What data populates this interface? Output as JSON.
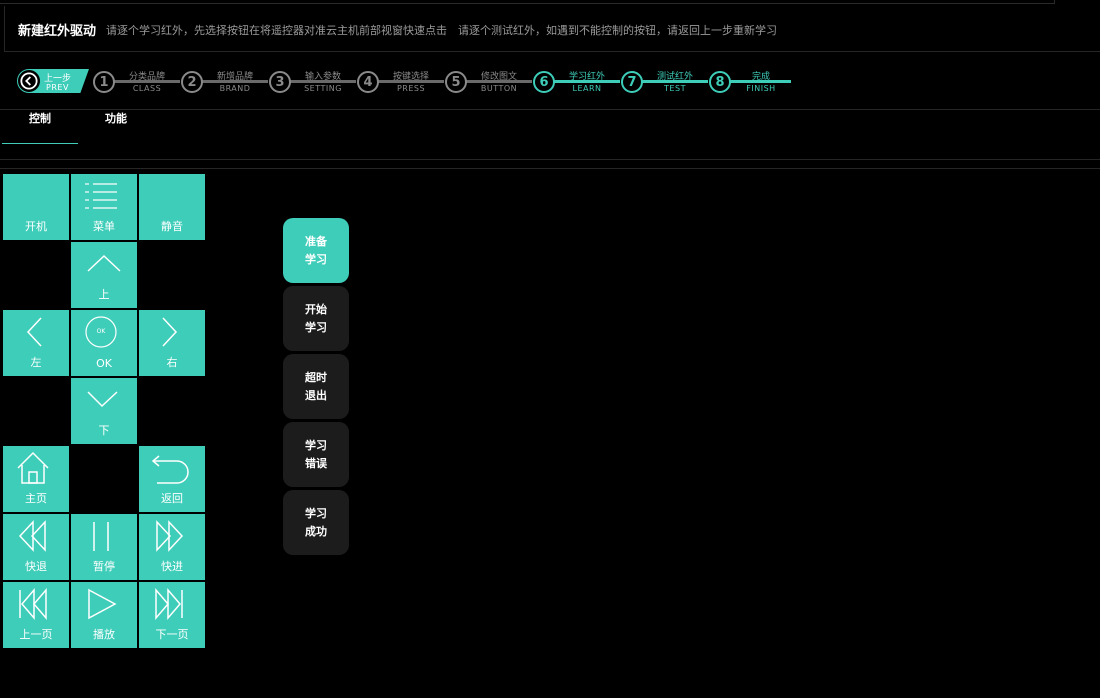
{
  "header": {
    "title": "新建红外驱动",
    "hint": "请逐个学习红外，先选择按钮在将遥控器对准云主机前部视窗快速点击　请逐个测试红外，如遇到不能控制的按钮，请返回上一步重新学习"
  },
  "prev": {
    "label": "上一步",
    "sub": "PREV"
  },
  "steps": [
    {
      "num": "1",
      "label": "分类品牌",
      "sub": "CLASS",
      "active": false
    },
    {
      "num": "2",
      "label": "新增品牌",
      "sub": "BRAND",
      "active": false
    },
    {
      "num": "3",
      "label": "输入参数",
      "sub": "SETTING",
      "active": false
    },
    {
      "num": "4",
      "label": "按键选择",
      "sub": "PRESS",
      "active": false
    },
    {
      "num": "5",
      "label": "修改图文",
      "sub": "BUTTON",
      "active": false
    },
    {
      "num": "6",
      "label": "学习红外",
      "sub": "LEARN",
      "active": true
    },
    {
      "num": "7",
      "label": "测试红外",
      "sub": "TEST",
      "active": true
    },
    {
      "num": "8",
      "label": "完成",
      "sub": "FINISH",
      "active": true
    }
  ],
  "tabs": [
    {
      "label": "控制",
      "active": true
    },
    {
      "label": "功能",
      "active": false
    }
  ],
  "keys": {
    "power": "开机",
    "menu": "菜单",
    "mute": "静音",
    "up": "上",
    "left": "左",
    "ok": "OK",
    "ok_icon": "OK",
    "right": "右",
    "down": "下",
    "home": "主页",
    "back": "返回",
    "rewind": "快退",
    "pause": "暂停",
    "forward": "快进",
    "prev_page": "上一页",
    "play": "播放",
    "next_page": "下一页"
  },
  "learn_panel": [
    {
      "line1": "准备",
      "line2": "学习",
      "active": true
    },
    {
      "line1": "开始",
      "line2": "学习",
      "active": false
    },
    {
      "line1": "超时",
      "line2": "退出",
      "active": false
    },
    {
      "line1": "学习",
      "line2": "错误",
      "active": false
    },
    {
      "line1": "学习",
      "line2": "成功",
      "active": false
    }
  ],
  "colors": {
    "accent": "#3ecdb9",
    "inactive": "#8a8a8a",
    "panel_bg": "#1c1c1c"
  }
}
